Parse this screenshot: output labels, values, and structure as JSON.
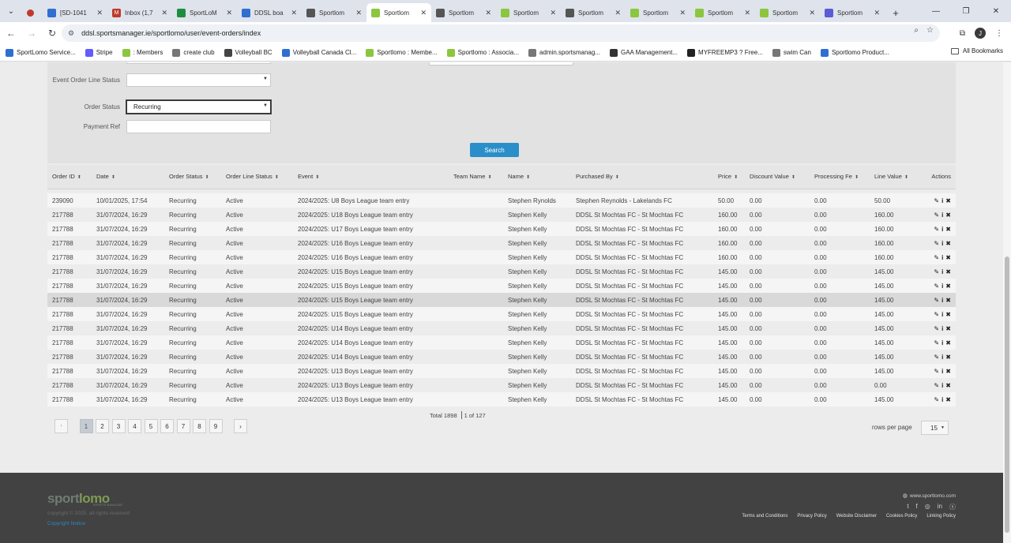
{
  "browser": {
    "tabs": [
      {
        "title": "",
        "icon": "record-icon",
        "color": "#c0392b",
        "active": false
      },
      {
        "title": "[SD-1041",
        "icon": "jira-icon",
        "color": "#2f6fd1",
        "active": false
      },
      {
        "title": "Inbox (1,7",
        "icon": "gmail-icon",
        "color": "#c0392b",
        "active": false
      },
      {
        "title": "SportLoM",
        "icon": "sheet-icon",
        "color": "#1e8e3e",
        "active": false
      },
      {
        "title": "DDSL boa",
        "icon": "jira-icon",
        "color": "#2f6fd1",
        "active": false
      },
      {
        "title": "Sportlom",
        "icon": "globe-icon",
        "color": "#555555",
        "active": false
      },
      {
        "title": "Sportlom",
        "icon": "sportlomo-icon",
        "color": "#8cc63f",
        "active": true
      },
      {
        "title": "Sportlom",
        "icon": "globe-icon",
        "color": "#555555",
        "active": false
      },
      {
        "title": "Sportlom",
        "icon": "sportlomo-icon",
        "color": "#8cc63f",
        "active": false
      },
      {
        "title": "Sportlom",
        "icon": "globe-icon",
        "color": "#555555",
        "active": false
      },
      {
        "title": "Sportlom",
        "icon": "sportlomo-icon",
        "color": "#8cc63f",
        "active": false
      },
      {
        "title": "Sportlom",
        "icon": "sportlomo-icon",
        "color": "#8cc63f",
        "active": false
      },
      {
        "title": "Sportlom",
        "icon": "sportlomo-icon",
        "color": "#8cc63f",
        "active": false
      },
      {
        "title": "Sportlom",
        "icon": "gear-icon",
        "color": "#5b5bd6",
        "active": false
      }
    ],
    "url": "ddsl.sportsmanager.ie/sportlomo/user/event-orders/index",
    "profile_initial": "J",
    "bookmarks": [
      {
        "label": "SportLomo Service...",
        "color": "#2f6fd1"
      },
      {
        "label": "Stripe",
        "color": "#635bff"
      },
      {
        "label": ": Members",
        "color": "#8cc63f"
      },
      {
        "label": "create club",
        "color": "#777777"
      },
      {
        "label": "Volleyball BC",
        "color": "#444444"
      },
      {
        "label": "Volleyball Canada Cl...",
        "color": "#2f6fd1"
      },
      {
        "label": "Sportlomo : Membe...",
        "color": "#8cc63f"
      },
      {
        "label": "Sportlomo : Associa...",
        "color": "#8cc63f"
      },
      {
        "label": "admin.sportsmanag...",
        "color": "#777777"
      },
      {
        "label": "GAA Management...",
        "color": "#333333"
      },
      {
        "label": "MYFREEMP3 ? Free...",
        "color": "#222222"
      },
      {
        "label": "swim Can",
        "color": "#777777"
      },
      {
        "label": "Sportlomo Product...",
        "color": "#2f6fd1"
      }
    ],
    "all_bookmarks": "All Bookmarks"
  },
  "filters": {
    "event_order_line_status_label": "Event Order Line Status",
    "event_order_line_status_value": "",
    "order_status_label": "Order Status",
    "order_status_value": "Recurring",
    "payment_ref_label": "Payment Ref",
    "payment_ref_value": "",
    "search_button": "Search"
  },
  "table": {
    "columns": [
      "Order ID",
      "Date",
      "Order Status",
      "Order Line Status",
      "Event",
      "Team Name",
      "Name",
      "Purchased By",
      "Price",
      "Discount Value",
      "Processing Fe",
      "Line Value"
    ],
    "actions_header": "Actions",
    "rows": [
      [
        "239090",
        "10/01/2025, 17:54",
        "Recurring",
        "Active",
        "2024/2025: U8 Boys League team entry",
        "",
        "Stephen Rynolds",
        "Stephen Reynolds - Lakelands FC",
        "50.00",
        "0.00",
        "0.00",
        "50.00"
      ],
      [
        "217788",
        "31/07/2024, 16:29",
        "Recurring",
        "Active",
        "2024/2025: U18 Boys League team entry",
        "",
        "Stephen Kelly",
        "DDSL St Mochtas FC - St Mochtas FC",
        "160.00",
        "0.00",
        "0.00",
        "160.00"
      ],
      [
        "217788",
        "31/07/2024, 16:29",
        "Recurring",
        "Active",
        "2024/2025: U17 Boys League team entry",
        "",
        "Stephen Kelly",
        "DDSL St Mochtas FC - St Mochtas FC",
        "160.00",
        "0.00",
        "0.00",
        "160.00"
      ],
      [
        "217788",
        "31/07/2024, 16:29",
        "Recurring",
        "Active",
        "2024/2025: U16 Boys League team entry",
        "",
        "Stephen Kelly",
        "DDSL St Mochtas FC - St Mochtas FC",
        "160.00",
        "0.00",
        "0.00",
        "160.00"
      ],
      [
        "217788",
        "31/07/2024, 16:29",
        "Recurring",
        "Active",
        "2024/2025: U16 Boys League team entry",
        "",
        "Stephen Kelly",
        "DDSL St Mochtas FC - St Mochtas FC",
        "160.00",
        "0.00",
        "0.00",
        "160.00"
      ],
      [
        "217788",
        "31/07/2024, 16:29",
        "Recurring",
        "Active",
        "2024/2025: U15 Boys League team entry",
        "",
        "Stephen Kelly",
        "DDSL St Mochtas FC - St Mochtas FC",
        "145.00",
        "0.00",
        "0.00",
        "145.00"
      ],
      [
        "217788",
        "31/07/2024, 16:29",
        "Recurring",
        "Active",
        "2024/2025: U15 Boys League team entry",
        "",
        "Stephen Kelly",
        "DDSL St Mochtas FC - St Mochtas FC",
        "145.00",
        "0.00",
        "0.00",
        "145.00"
      ],
      [
        "217788",
        "31/07/2024, 16:29",
        "Recurring",
        "Active",
        "2024/2025: U15 Boys League team entry",
        "",
        "Stephen Kelly",
        "DDSL St Mochtas FC - St Mochtas FC",
        "145.00",
        "0.00",
        "0.00",
        "145.00"
      ],
      [
        "217788",
        "31/07/2024, 16:29",
        "Recurring",
        "Active",
        "2024/2025: U15 Boys League team entry",
        "",
        "Stephen Kelly",
        "DDSL St Mochtas FC - St Mochtas FC",
        "145.00",
        "0.00",
        "0.00",
        "145.00"
      ],
      [
        "217788",
        "31/07/2024, 16:29",
        "Recurring",
        "Active",
        "2024/2025: U14 Boys League team entry",
        "",
        "Stephen Kelly",
        "DDSL St Mochtas FC - St Mochtas FC",
        "145.00",
        "0.00",
        "0.00",
        "145.00"
      ],
      [
        "217788",
        "31/07/2024, 16:29",
        "Recurring",
        "Active",
        "2024/2025: U14 Boys League team entry",
        "",
        "Stephen Kelly",
        "DDSL St Mochtas FC - St Mochtas FC",
        "145.00",
        "0.00",
        "0.00",
        "145.00"
      ],
      [
        "217788",
        "31/07/2024, 16:29",
        "Recurring",
        "Active",
        "2024/2025: U14 Boys League team entry",
        "",
        "Stephen Kelly",
        "DDSL St Mochtas FC - St Mochtas FC",
        "145.00",
        "0.00",
        "0.00",
        "145.00"
      ],
      [
        "217788",
        "31/07/2024, 16:29",
        "Recurring",
        "Active",
        "2024/2025: U13 Boys League team entry",
        "",
        "Stephen Kelly",
        "DDSL St Mochtas FC - St Mochtas FC",
        "145.00",
        "0.00",
        "0.00",
        "145.00"
      ],
      [
        "217788",
        "31/07/2024, 16:29",
        "Recurring",
        "Active",
        "2024/2025: U13 Boys League team entry",
        "",
        "Stephen Kelly",
        "DDSL St Mochtas FC - St Mochtas FC",
        "145.00",
        "0.00",
        "0.00",
        "0.00"
      ],
      [
        "217788",
        "31/07/2024, 16:29",
        "Recurring",
        "Active",
        "2024/2025: U13 Boys League team entry",
        "",
        "Stephen Kelly",
        "DDSL St Mochtas FC - St Mochtas FC",
        "145.00",
        "0.00",
        "0.00",
        "145.00"
      ]
    ],
    "highlighted_row": 7
  },
  "summary": {
    "total": "Total 1898",
    "page_of": "1 of 127"
  },
  "pagination": {
    "prev": "‹",
    "next": "›",
    "pages": [
      "1",
      "2",
      "3",
      "4",
      "5",
      "6",
      "7",
      "8",
      "9"
    ],
    "current": "1"
  },
  "rows_per_page": {
    "label": "rows per page",
    "value": "15"
  },
  "footer": {
    "logo_main": "sport",
    "logo_accent": "lomo",
    "logo_sub": "SPORTS MANAGER",
    "copyright": "copyright © 2025. all rights reserved",
    "copyright_link": "Copyright Notice",
    "website": "www.sportlomo.com",
    "links": [
      "Terms and Conditions",
      "Privacy Policy",
      "Website Disclaimer",
      "Cookies Policy",
      "Linking Policy"
    ]
  }
}
